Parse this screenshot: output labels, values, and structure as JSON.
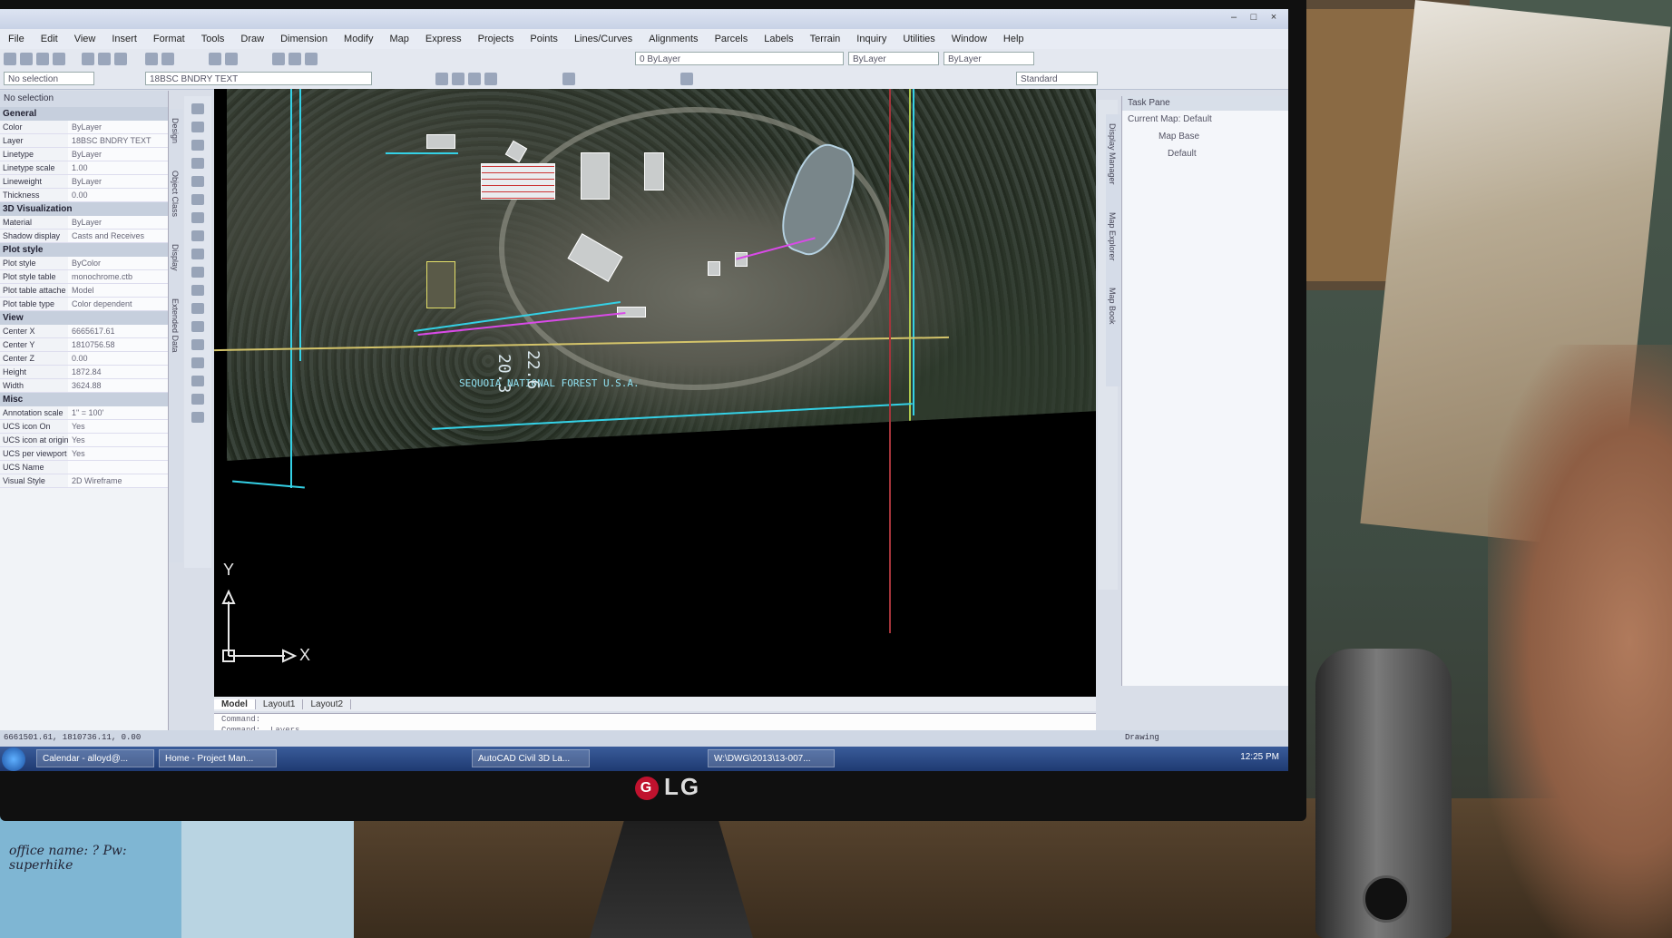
{
  "app": {
    "menu": [
      "File",
      "Edit",
      "View",
      "Insert",
      "Format",
      "Tools",
      "Draw",
      "Dimension",
      "Modify",
      "Map",
      "Express",
      "Projects",
      "Points",
      "Lines/Curves",
      "Alignments",
      "Parcels",
      "Labels",
      "Terrain",
      "Inquiry",
      "Utilities",
      "Window",
      "Help"
    ],
    "layer_field": "0   ByLayer",
    "lineweight_field": "ByLayer",
    "linetype_field": "ByLayer",
    "layer_name": "18BSC BNDRY TEXT",
    "style_field": "Standard"
  },
  "properties": {
    "header": "No selection",
    "sections": [
      {
        "title": "General",
        "rows": [
          {
            "k": "Color",
            "v": "ByLayer"
          },
          {
            "k": "Layer",
            "v": "18BSC BNDRY TEXT"
          },
          {
            "k": "Linetype",
            "v": "ByLayer"
          },
          {
            "k": "Linetype scale",
            "v": "1.00"
          },
          {
            "k": "Lineweight",
            "v": "ByLayer"
          },
          {
            "k": "Thickness",
            "v": "0.00"
          }
        ]
      },
      {
        "title": "3D Visualization",
        "rows": [
          {
            "k": "Material",
            "v": "ByLayer"
          },
          {
            "k": "Shadow display",
            "v": "Casts and Receives"
          }
        ]
      },
      {
        "title": "Plot style",
        "rows": [
          {
            "k": "Plot style",
            "v": "ByColor"
          },
          {
            "k": "Plot style table",
            "v": "monochrome.ctb"
          },
          {
            "k": "Plot table attache",
            "v": "Model"
          },
          {
            "k": "Plot table type",
            "v": "Color dependent"
          }
        ]
      },
      {
        "title": "View",
        "rows": [
          {
            "k": "Center X",
            "v": "6665617.61"
          },
          {
            "k": "Center Y",
            "v": "1810756.58"
          },
          {
            "k": "Center Z",
            "v": "0.00"
          },
          {
            "k": "Height",
            "v": "1872.84"
          },
          {
            "k": "Width",
            "v": "3624.88"
          }
        ]
      },
      {
        "title": "Misc",
        "rows": [
          {
            "k": "Annotation scale",
            "v": "1\" = 100'"
          },
          {
            "k": "UCS icon On",
            "v": "Yes"
          },
          {
            "k": "UCS icon at origin",
            "v": "Yes"
          },
          {
            "k": "UCS per viewport",
            "v": "Yes"
          },
          {
            "k": "UCS Name",
            "v": ""
          },
          {
            "k": "Visual Style",
            "v": "2D Wireframe"
          }
        ]
      }
    ],
    "side_tabs": [
      "Design",
      "Object Class",
      "Display",
      "Extended Data"
    ]
  },
  "drawing": {
    "labels": {
      "forest": "SEQUOIA    NATIONAL    FOREST    U.S.A.",
      "num1": "20.3",
      "num2": "22.6",
      "ucs_y": "Y",
      "ucs_x": "X"
    },
    "tabs": [
      "Model",
      "Layout1",
      "Layout2"
    ],
    "command_lines": [
      "Command:",
      "Command:  _Layers",
      "Command:",
      "Command:"
    ]
  },
  "taskpane": {
    "title": "Task Pane",
    "current_map_label": "Current Map:",
    "current_map_value": "Default",
    "items": [
      "Map Base",
      "Default"
    ],
    "side_tabs": [
      "Display Manager",
      "Map Explorer",
      "Map Book"
    ]
  },
  "status": {
    "coords": "6661501.61, 1810736.11, 0.00",
    "annotation": "Drawing",
    "time": "12:25 PM"
  },
  "taskbar": {
    "items": [
      "Calendar - alloyd@...",
      "Home - Project Man...",
      "AutoCAD Civil 3D La...",
      "W:\\DWG\\2013\\13-007..."
    ]
  },
  "desk": {
    "sticky_note": "office name: ?\nPw: superhike",
    "monitor_brand": "LG"
  },
  "colors": {
    "cyan": "#34d1e6",
    "magenta": "#d94ae8",
    "yellow": "#d4c46a",
    "red": "#a3343a"
  }
}
